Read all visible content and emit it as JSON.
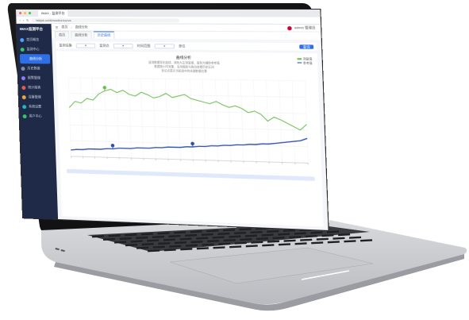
{
  "browser": {
    "tab_title": "IMAX - 监测平台",
    "url": "fxbjvk.cn/#/monitor/curve"
  },
  "app": {
    "brand": "IMAX监测平台"
  },
  "sidebar": {
    "items": [
      {
        "label": "首页概览",
        "color": "#4aa3ff"
      },
      {
        "label": "监测中心",
        "color": "#36c36b"
      },
      {
        "label": "曲线分析",
        "color": "#2f6fe6"
      },
      {
        "label": "历史数据",
        "color": "#7d8bb0"
      },
      {
        "label": "报警管理",
        "color": "#8a7dff"
      },
      {
        "label": "统计报表",
        "color": "#e85a5a"
      },
      {
        "label": "设备管理",
        "color": "#f2a93b"
      },
      {
        "label": "系统设置",
        "color": "#23b6c9"
      },
      {
        "label": "用户中心",
        "color": "#36c36b"
      }
    ]
  },
  "topbar": {
    "crumbs": [
      "首页",
      "曲线分析"
    ],
    "user": "admin 管理员"
  },
  "subtabs": [
    "首页",
    "曲线分析",
    "历史曲线"
  ],
  "filters": {
    "device_label": "监测设备",
    "point_label": "监测点",
    "time_label": "时间范围",
    "unit_label": "单位",
    "query_button": "查询"
  },
  "chart": {
    "title": "曲线分析",
    "desc_lines": [
      "监测数据变化曲线，绿色为主测量值，蓝色为辅助参考值",
      "数据按小时采集，支持缩放与拖动查看历史区间",
      "标记点表示当前选中的关键数据位置"
    ],
    "legend": [
      "测量值",
      "参考值"
    ],
    "colors": {
      "green": "#6cbf4e",
      "blue": "#2e4fb0"
    }
  },
  "chart_data": {
    "type": "line",
    "series": [
      {
        "values": [
          62,
          70,
          68,
          74,
          72,
          80,
          84,
          86,
          82,
          85,
          80,
          78,
          83,
          80,
          76,
          78,
          82,
          77,
          79,
          81,
          76,
          74,
          72,
          70,
          73,
          69,
          66,
          68,
          65,
          60,
          62,
          58,
          50,
          55,
          52,
          48,
          44,
          40,
          47
        ]
      },
      {
        "values": [
          8,
          9,
          9,
          10,
          10,
          10,
          11,
          11,
          12,
          12,
          12,
          13,
          13,
          13,
          14,
          14,
          15,
          15,
          15,
          16,
          16,
          17,
          17,
          18,
          18,
          19,
          19,
          20,
          20,
          21,
          21,
          22,
          22,
          23,
          24,
          25,
          26,
          27,
          30
        ]
      }
    ],
    "ylim": [
      0,
      100
    ],
    "grid": true
  }
}
